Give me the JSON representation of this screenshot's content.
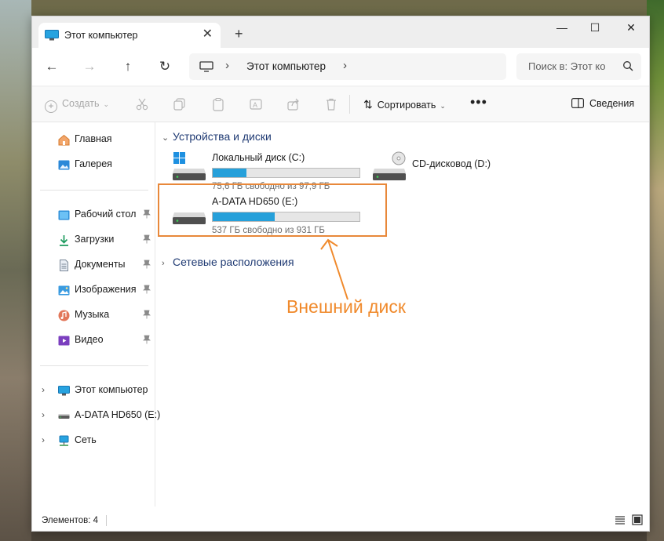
{
  "window": {
    "tab_title": "Этот компьютер",
    "tab_close": "✕",
    "new_tab": "+",
    "controls": [
      "—",
      "☐",
      "✕"
    ]
  },
  "address": {
    "crumb": "Этот компьютер",
    "search_placeholder": "Поиск в: Этот ко"
  },
  "toolbar": {
    "create_label": "Создать",
    "sort_label": "Сортировать",
    "more_label": "•••",
    "details_label": "Сведения"
  },
  "sidebar": {
    "top_items": [
      {
        "label": "Главная",
        "icon": "home-icon"
      },
      {
        "label": "Галерея",
        "icon": "gallery-icon"
      }
    ],
    "pinned_items": [
      {
        "label": "Рабочий стол",
        "icon": "desktop-icon"
      },
      {
        "label": "Загрузки",
        "icon": "download-icon"
      },
      {
        "label": "Документы",
        "icon": "documents-icon"
      },
      {
        "label": "Изображения",
        "icon": "pictures-icon"
      },
      {
        "label": "Музыка",
        "icon": "music-icon"
      },
      {
        "label": "Видео",
        "icon": "video-icon"
      }
    ],
    "tree_items": [
      {
        "label": "Этот компьютер",
        "icon": "computer-icon"
      },
      {
        "label": "A-DATA HD650 (E:)",
        "icon": "drive-icon"
      },
      {
        "label": "Сеть",
        "icon": "network-icon"
      }
    ]
  },
  "main": {
    "group_devices": "Устройства и диски",
    "group_network": "Сетевые расположения",
    "drives": [
      {
        "name": "Локальный диск (C:)",
        "free_text": "75,6 ГБ свободно из 97,9 ГБ",
        "used_fraction": 0.23
      },
      {
        "name": "CD-дисковод (D:)"
      },
      {
        "name": "A-DATA HD650 (E:)",
        "free_text": "537 ГБ свободно из 931 ГБ",
        "used_fraction": 0.42
      }
    ]
  },
  "status": {
    "items_label": "Элементов: 4"
  },
  "annotation": {
    "callout_text": "Внешний диск",
    "color": "#f08a2c"
  }
}
